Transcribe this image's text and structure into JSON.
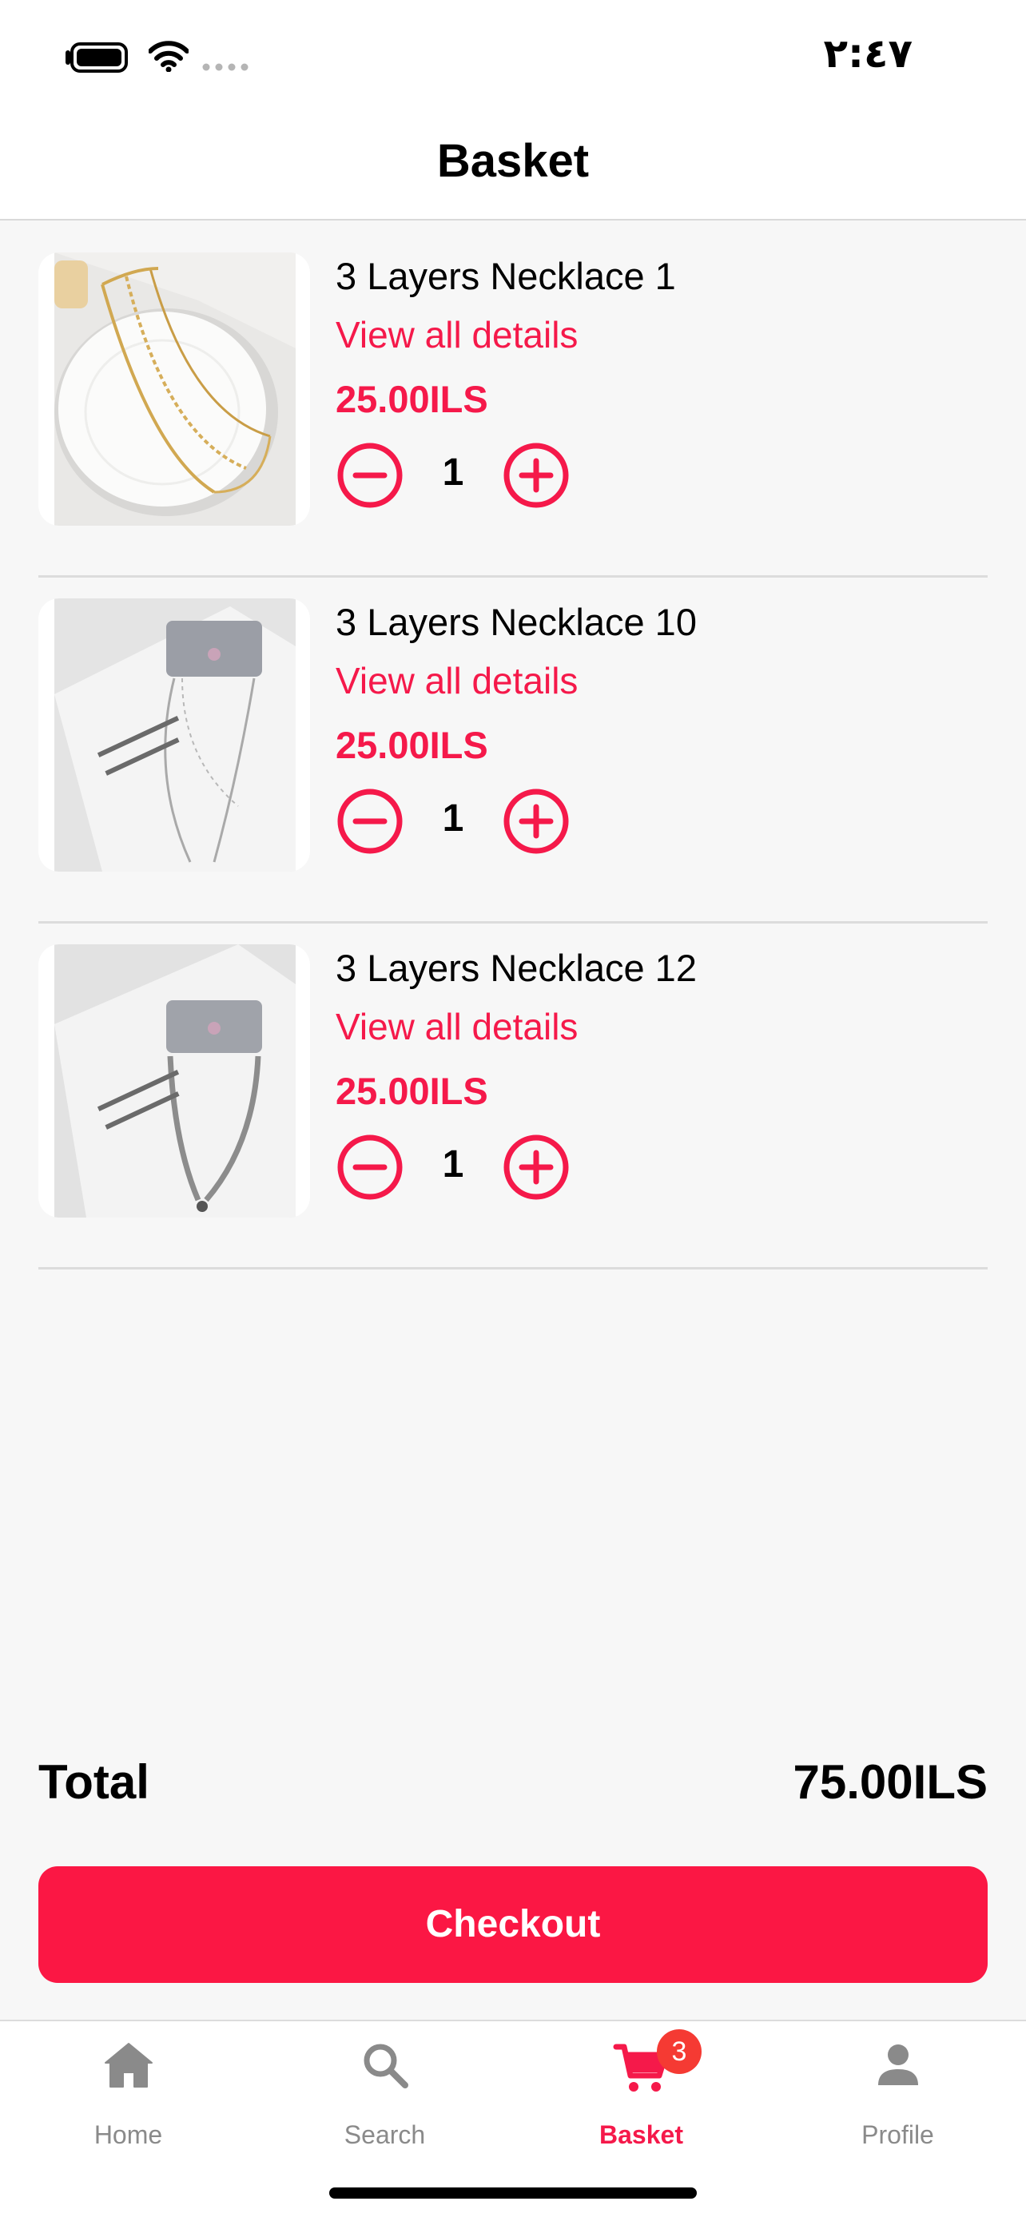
{
  "status_bar": {
    "time": "٢:٤٧"
  },
  "header": {
    "title": "Basket"
  },
  "basket": {
    "items": [
      {
        "name": "3 Layers Necklace 1",
        "link": "View all details",
        "price": "25.00ILS",
        "quantity": "1",
        "image": "gold-layered-necklace-photo"
      },
      {
        "name": "3 Layers Necklace 10",
        "link": "View all details",
        "price": "25.00ILS",
        "quantity": "1",
        "image": "silver-necklace-card-photo"
      },
      {
        "name": "3 Layers Necklace 12",
        "link": "View all details",
        "price": "25.00ILS",
        "quantity": "1",
        "image": "silver-snake-necklace-card-photo"
      }
    ]
  },
  "summary": {
    "total_label": "Total",
    "total_value": "75.00ILS",
    "checkout_label": "Checkout"
  },
  "tabbar": {
    "items": [
      {
        "label": "Home",
        "icon": "home-icon"
      },
      {
        "label": "Search",
        "icon": "search-icon"
      },
      {
        "label": "Basket",
        "icon": "cart-icon",
        "badge": "3",
        "active": true
      },
      {
        "label": "Profile",
        "icon": "person-icon"
      }
    ]
  },
  "colors": {
    "accent": "#f5194a",
    "checkout": "#fb1744",
    "badge": "#f53a33",
    "inactive_tab": "#8a8a8a"
  }
}
